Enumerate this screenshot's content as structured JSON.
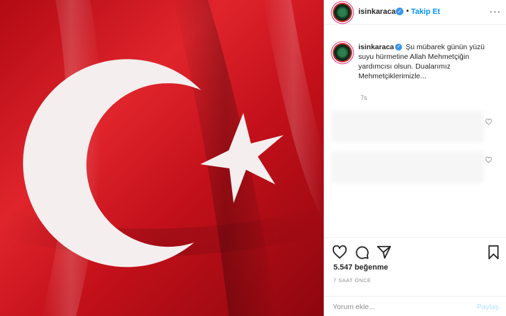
{
  "header": {
    "username": "isinkaraca",
    "follow_label": "Takip Et",
    "dot": "•",
    "more": "···"
  },
  "caption": {
    "username": "isinkaraca",
    "text": "Şu mübarek günün yüzü suyu hürmetine Allah Mehmetçiğin yardımcısı olsun. Dualarımız Mehmetçiklerimizle...",
    "time": "7s"
  },
  "actions": {
    "likes": "5.547 beğenme",
    "time_ago": "7 SAAT ÖNCE"
  },
  "comment": {
    "placeholder": "Yorum ekle...",
    "share_label": "Paylaş"
  },
  "colors": {
    "flag_red": "#d0121c",
    "flag_white": "#ffffff",
    "accent_blue": "#0095f6",
    "verified_blue": "#3897f0"
  },
  "icons": [
    "verified-icon",
    "more-icon",
    "heart-icon",
    "comment-icon",
    "share-icon",
    "bookmark-icon"
  ]
}
